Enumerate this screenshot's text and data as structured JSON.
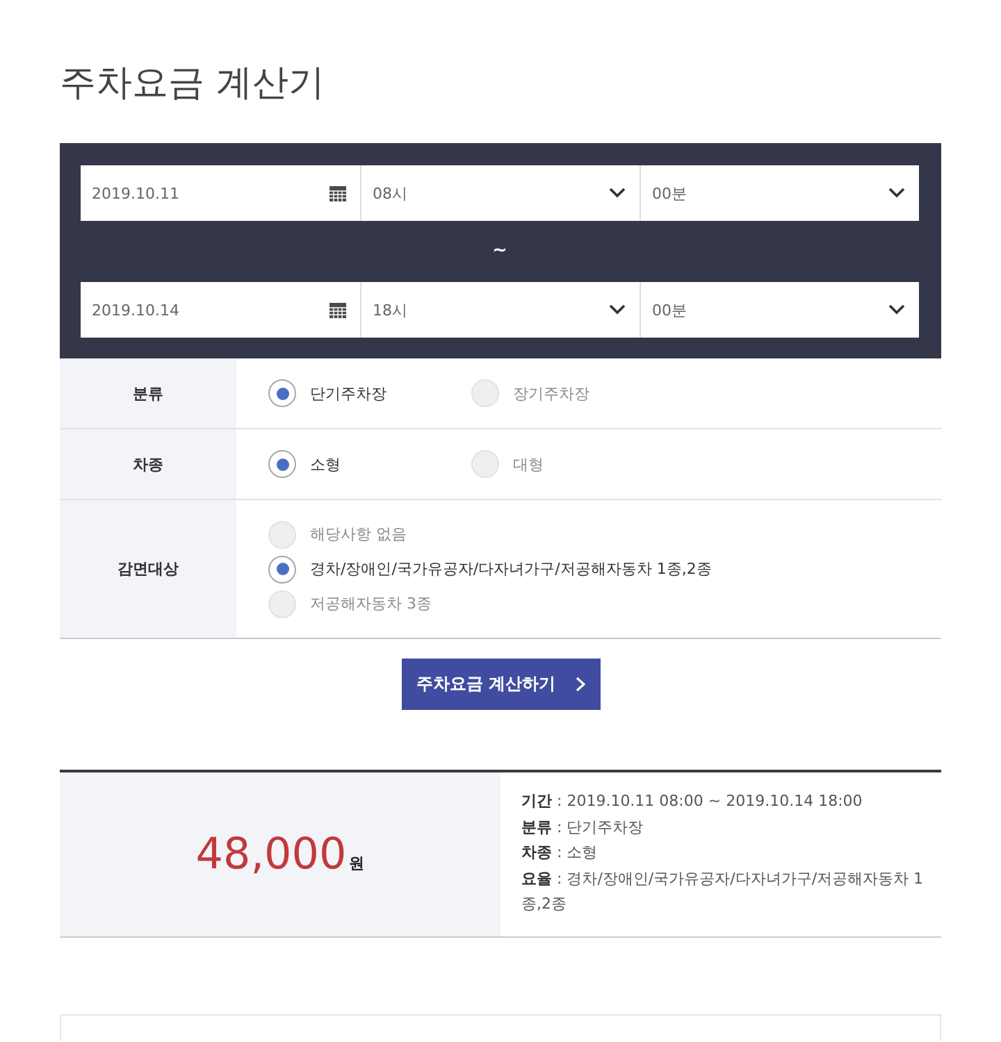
{
  "title": "주차요금 계산기",
  "period": {
    "start": {
      "date": "2019.10.11",
      "hour": "08시",
      "minute": "00분"
    },
    "separator": "~",
    "end": {
      "date": "2019.10.14",
      "hour": "18시",
      "minute": "00분"
    }
  },
  "options": [
    {
      "label": "분류",
      "kind": "inline",
      "choices": [
        {
          "label": "단기주차장",
          "selected": true
        },
        {
          "label": "장기주차장",
          "selected": false
        }
      ]
    },
    {
      "label": "차종",
      "kind": "inline",
      "choices": [
        {
          "label": "소형",
          "selected": true
        },
        {
          "label": "대형",
          "selected": false
        }
      ]
    },
    {
      "label": "감면대상",
      "kind": "stacked",
      "choices": [
        {
          "label": "해당사항 없음",
          "selected": false
        },
        {
          "label": "경차/장애인/국가유공자/다자녀가구/저공해자동차 1종,2종",
          "selected": true
        },
        {
          "label": "저공해자동차 3종",
          "selected": false
        }
      ]
    }
  ],
  "calculate_button": {
    "label": "주차요금 계산하기"
  },
  "result": {
    "amount": "48,000",
    "unit": "원",
    "details": [
      "**기간** : 2019.10.11 08:00 ~ 2019.10.14 18:00",
      "**분류** : 단기주차장",
      "**차종** : 소형",
      "**요율** : 경차/장애인/국가유공자/다자녀가구/저공해자동차 1종,2종"
    ]
  }
}
